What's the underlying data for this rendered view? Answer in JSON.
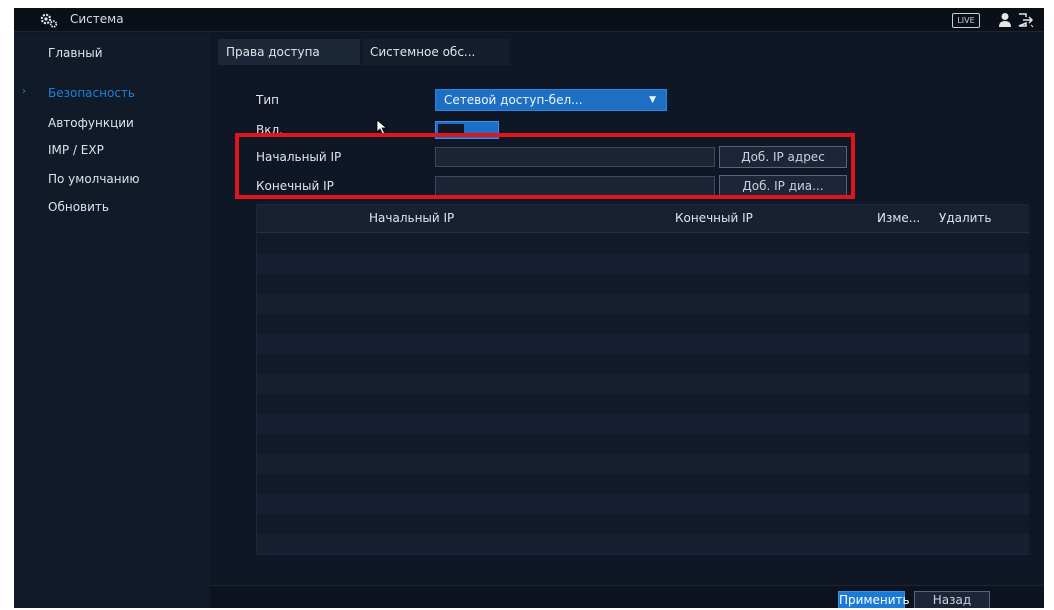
{
  "window": {
    "title": "Система",
    "live_label": "LIVE"
  },
  "sidebar": {
    "items": [
      {
        "label": "Главный",
        "active": false
      },
      {
        "label": "Безопасность",
        "active": true
      },
      {
        "label": "Автофункции",
        "active": false
      },
      {
        "label": "IMP / EXP",
        "active": false
      },
      {
        "label": "По умолчанию",
        "active": false
      },
      {
        "label": "Обновить",
        "active": false
      }
    ]
  },
  "tabs": [
    {
      "label": "Права доступа",
      "active": true
    },
    {
      "label": "Системное обс...",
      "active": false
    }
  ],
  "form": {
    "type_label": "Тип",
    "type_value": "Сетевой доступ-бел...",
    "enable_label": "Вкл.",
    "enabled": true,
    "start_ip_label": "Начальный IP",
    "start_ip_value": "",
    "add_ip_button": "Доб. IP адрес",
    "end_ip_label": "Конечный IP",
    "end_ip_value": "",
    "add_range_button": "Доб. IP диа..."
  },
  "table": {
    "headers": [
      "Начальный IP",
      "Конечный IP",
      "Изме...",
      "Удалить"
    ],
    "rows": []
  },
  "footer": {
    "apply": "Применить",
    "back": "Назад"
  },
  "colors": {
    "accent": "#1d7fd8",
    "highlight": "#e0151c",
    "background": "#0f1726"
  }
}
